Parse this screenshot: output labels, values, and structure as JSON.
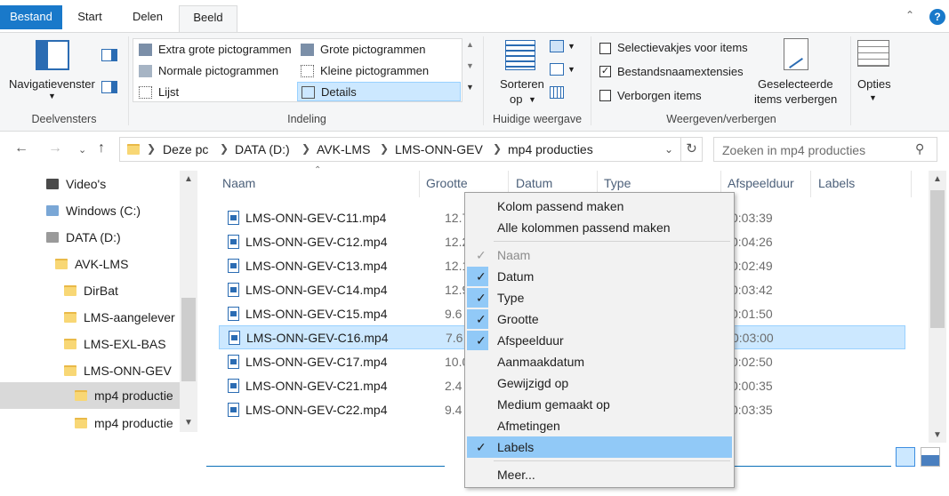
{
  "tabs": {
    "file": "Bestand",
    "start": "Start",
    "share": "Delen",
    "view": "Beeld"
  },
  "ribbon": {
    "panes": {
      "nav_pane": "Navigatievenster",
      "group": "Deelvensters"
    },
    "layout": {
      "extra_large": "Extra grote pictogrammen",
      "large": "Grote pictogrammen",
      "normal": "Normale pictogrammen",
      "small": "Kleine pictogrammen",
      "list": "Lijst",
      "details": "Details",
      "group": "Indeling"
    },
    "current_view": {
      "sort_line1": "Sorteren",
      "sort_line2": "op",
      "group": "Huidige weergave"
    },
    "show_hide": {
      "checkboxes": "Selectievakjes voor items",
      "extensions": "Bestandsnaamextensies",
      "hidden": "Verborgen items",
      "hide_sel_line1": "Geselecteerde",
      "hide_sel_line2": "items verbergen",
      "group": "Weergeven/verbergen"
    },
    "options": "Opties"
  },
  "address": {
    "crumbs": [
      "Deze pc",
      "DATA (D:)",
      "AVK-LMS",
      "LMS-ONN-GEV",
      "mp4 producties"
    ],
    "search_placeholder": "Zoeken in mp4 producties"
  },
  "nav": [
    "Video's",
    "Windows (C:)",
    "DATA (D:)",
    "AVK-LMS",
    "DirBat",
    "LMS-aangelever",
    "LMS-EXL-BAS",
    "LMS-ONN-GEV",
    "mp4 productie",
    "mp4 productie"
  ],
  "columns": {
    "name": "Naam",
    "size": "Grootte",
    "date": "Datum",
    "type": "Type",
    "duration": "Afspeelduur",
    "labels": "Labels"
  },
  "files": [
    {
      "name": "LMS-ONN-GEV-C11.mp4",
      "size": "12.7",
      "duration": "0:03:39"
    },
    {
      "name": "LMS-ONN-GEV-C12.mp4",
      "size": "12.2",
      "duration": "0:04:26"
    },
    {
      "name": "LMS-ONN-GEV-C13.mp4",
      "size": "12.1",
      "duration": "0:02:49"
    },
    {
      "name": "LMS-ONN-GEV-C14.mp4",
      "size": "12.9",
      "duration": "0:03:42"
    },
    {
      "name": "LMS-ONN-GEV-C15.mp4",
      "size": "9.6",
      "duration": "0:01:50"
    },
    {
      "name": "LMS-ONN-GEV-C16.mp4",
      "size": "7.6",
      "duration": "0:03:00"
    },
    {
      "name": "LMS-ONN-GEV-C17.mp4",
      "size": "10.0",
      "duration": "0:02:50"
    },
    {
      "name": "LMS-ONN-GEV-C21.mp4",
      "size": "2.4",
      "duration": "0:00:35"
    },
    {
      "name": "LMS-ONN-GEV-C22.mp4",
      "size": "9.4",
      "duration": "0:03:35"
    }
  ],
  "context_menu": {
    "fit_column": "Kolom passend maken",
    "fit_all": "Alle kolommen passend maken",
    "items": [
      "Naam",
      "Datum",
      "Type",
      "Grootte",
      "Afspeelduur",
      "Aanmaakdatum",
      "Gewijzigd op",
      "Medium gemaakt op",
      "Afmetingen",
      "Labels"
    ],
    "checked": [
      true,
      true,
      true,
      true,
      true,
      false,
      false,
      false,
      false,
      true
    ],
    "more": "Meer..."
  },
  "colors": {
    "accent": "#1979ca",
    "selection": "#cce8ff",
    "menu_highlight": "#91c9f7"
  }
}
